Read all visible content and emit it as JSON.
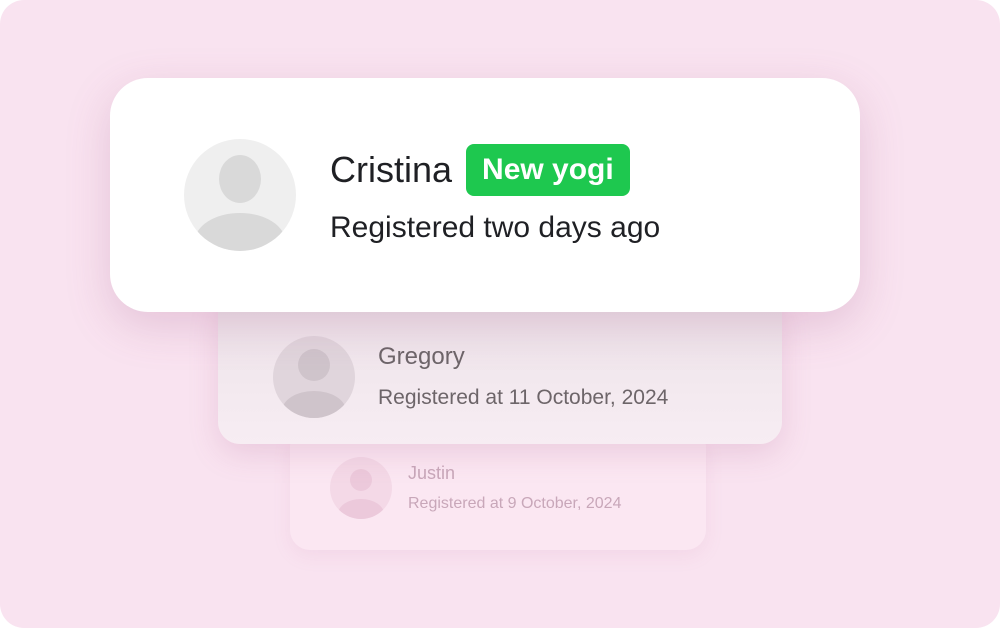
{
  "cards": [
    {
      "name": "Cristina",
      "badge": "New yogi",
      "subtitle": "Registered two days ago"
    },
    {
      "name": "Gregory",
      "subtitle": "Registered at 11 October, 2024"
    },
    {
      "name": "Justin",
      "subtitle": "Registered at 9 October, 2024"
    }
  ],
  "colors": {
    "background": "#f9e3f0",
    "badge": "#1ec84f",
    "primary_text": "#1f2024"
  },
  "icons": {
    "avatar": "user-avatar-placeholder-icon"
  }
}
